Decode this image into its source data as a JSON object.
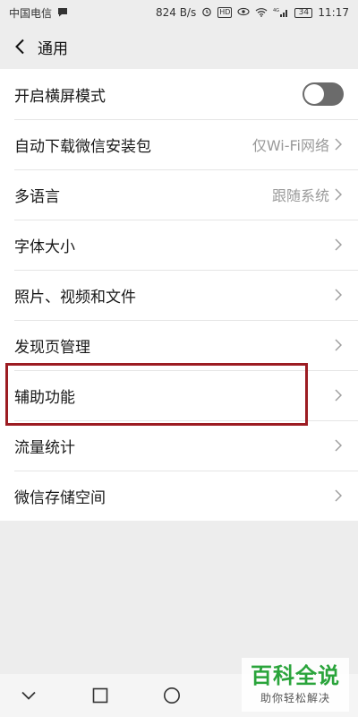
{
  "status_bar": {
    "carrier": "中国电信",
    "speed": "824 B/s",
    "hd": "HD",
    "network": "4G",
    "battery": "34",
    "time": "11:17"
  },
  "nav": {
    "title": "通用"
  },
  "settings": {
    "items": [
      {
        "label": "开启横屏模式",
        "toggle_on": false
      },
      {
        "label": "自动下载微信安装包",
        "value": "仅Wi-Fi网络"
      },
      {
        "label": "多语言",
        "value": "跟随系统"
      },
      {
        "label": "字体大小"
      },
      {
        "label": "照片、视频和文件"
      },
      {
        "label": "发现页管理"
      },
      {
        "label": "辅助功能"
      },
      {
        "label": "流量统计"
      },
      {
        "label": "微信存储空间"
      }
    ]
  },
  "watermark": {
    "title": "百科全说",
    "subtitle": "助你轻松解决"
  },
  "colors": {
    "background": "#ededed",
    "highlight": "#9c1c22",
    "toggle_off": "#6b6b6b",
    "watermark_green": "#2aa43b"
  }
}
